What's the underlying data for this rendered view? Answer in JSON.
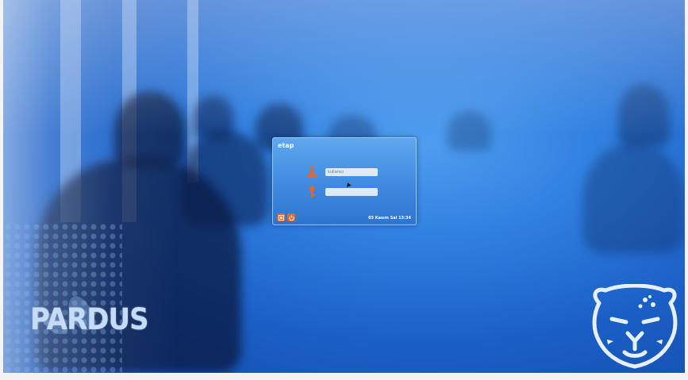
{
  "login": {
    "title": "etap",
    "username_placeholder": "kullanıcı",
    "password_value": "",
    "clock": "03 Kasım Sal 13:34",
    "buttons": [
      {
        "icon": "session-icon",
        "color": "#e2662f"
      },
      {
        "icon": "power-icon",
        "color": "#e2662f"
      }
    ]
  },
  "branding": {
    "distro_name": "PARDUS",
    "mascot": "leopard-logo-icon"
  },
  "colors": {
    "background": "#2f7fe0",
    "dialog": "#3f8ae0",
    "accent": "#e2662f"
  }
}
